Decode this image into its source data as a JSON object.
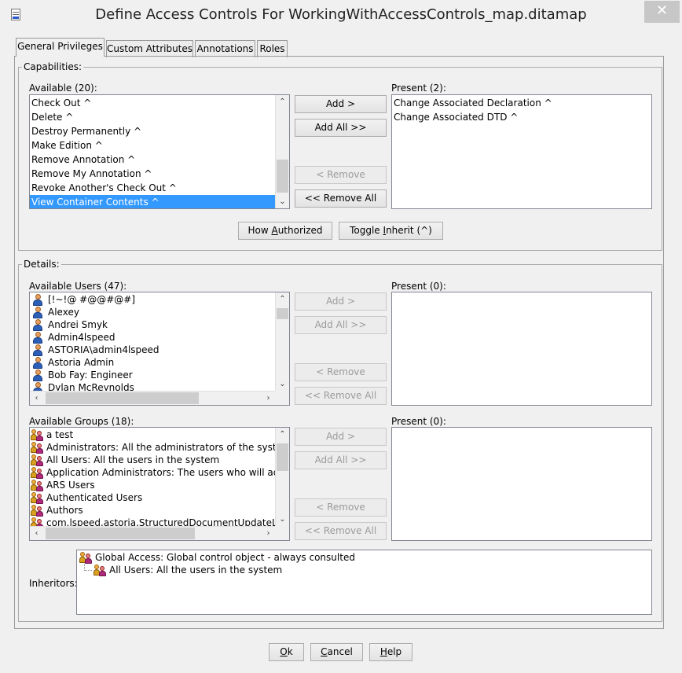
{
  "window": {
    "title": "Define Access Controls For WorkingWithAccessControls_map.ditamap",
    "close_glyph": "✕"
  },
  "tabs": [
    {
      "label": "General Privileges"
    },
    {
      "label": "Custom Attributes"
    },
    {
      "label": "Annotations"
    },
    {
      "label": "Roles"
    }
  ],
  "capabilities": {
    "group_title": "Capabilities:",
    "available_label": "Available (20):",
    "present_label": "Present (2):",
    "available_items": [
      "Check Out ^",
      "Delete ^",
      "Destroy Permanently ^",
      "Make Edition ^",
      "Remove Annotation ^",
      "Remove My Annotation ^",
      "Revoke Another's Check Out ^",
      "View Container Contents ^"
    ],
    "selected_index": 7,
    "present_items": [
      "Change Associated Declaration ^",
      "Change Associated DTD ^"
    ],
    "add_label": "Add >",
    "add_all_label": "Add All >>",
    "remove_label": "< Remove",
    "remove_all_label": "<< Remove All",
    "how_authorized_pre": "How ",
    "how_authorized_key": "A",
    "how_authorized_post": "uthorized",
    "toggle_pre": "Toggle ",
    "toggle_key": "I",
    "toggle_post": "nherit (^)"
  },
  "details": {
    "group_title": "Details:",
    "users_label": "Available Users (47):",
    "users_present_label": "Present (0):",
    "users": [
      "[!~!@ #@@#@#]",
      "Alexey",
      "Andrei Smyk",
      "Admin4lspeed",
      "ASTORIA\\admin4lspeed",
      "Astoria Admin",
      "Bob Fay: Engineer",
      "Dylan McReynolds"
    ],
    "groups_label": "Available Groups (18):",
    "groups_present_label": "Present (0):",
    "groups": [
      "a test",
      "Administrators: All the administrators of the system",
      "All Users: All the users in the system",
      "Application Administrators: The users who will administer",
      "ARS Users",
      "Authenticated Users",
      "Authors",
      "com.lspeed.astoria.StructuredDocumentUpdateLicense"
    ],
    "add_label": "Add >",
    "add_all_label": "Add All >>",
    "remove_label": "< Remove",
    "remove_all_label": "<< Remove All",
    "inheritors_label": "Inheritors:",
    "inheritors": [
      "Global Access: Global control object - always consulted",
      "All Users: All the users in the system"
    ]
  },
  "footer": {
    "ok_key": "O",
    "ok_post": "k",
    "cancel_key": "C",
    "cancel_post": "ancel",
    "help_key": "H",
    "help_post": "elp"
  },
  "colors": {
    "selection": "#3399ff",
    "window_bg": "#f0f0f0",
    "disabled_text": "#9b9b9b"
  }
}
